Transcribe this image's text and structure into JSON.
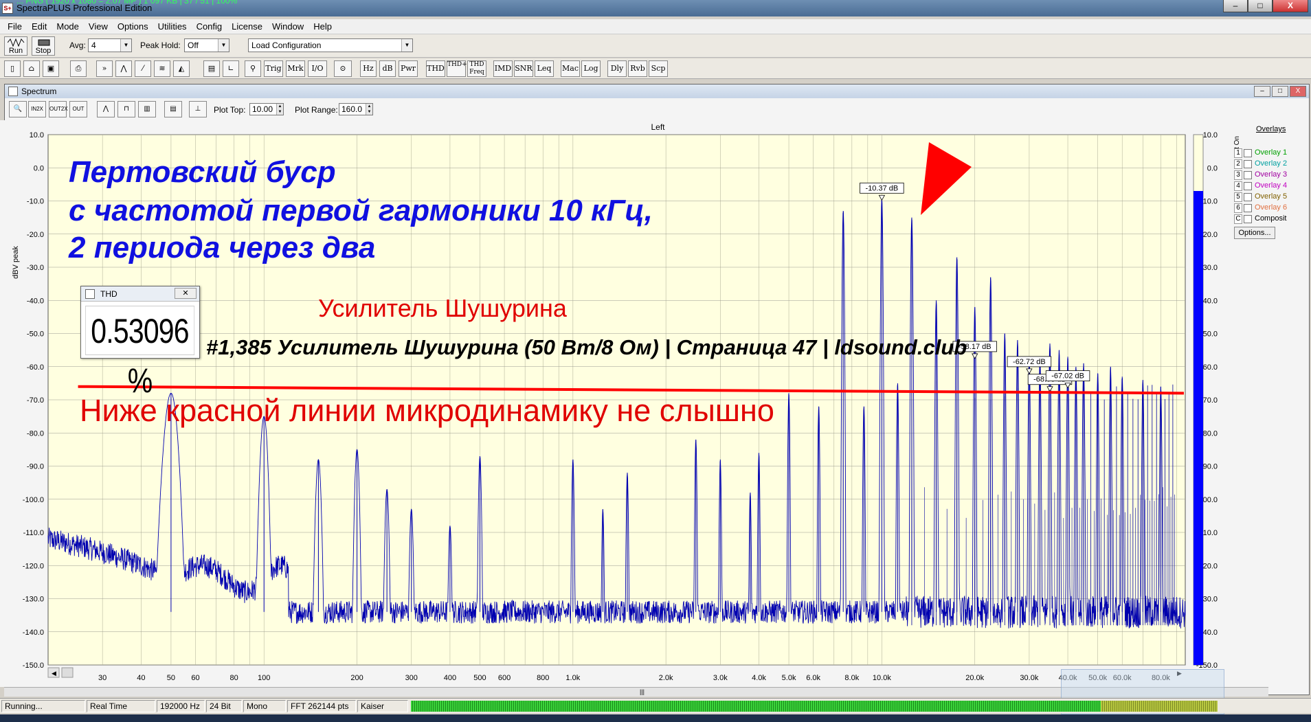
{
  "window": {
    "title": "SpectraPLUS Professional Edition",
    "overlay_text": "... PNG ( 1920 x 1080 = 2.07 MP ) 1 097 KB | 37 / 51 | 100%",
    "buttons": [
      "–",
      "□",
      "X"
    ]
  },
  "menu": [
    "File",
    "Edit",
    "Mode",
    "View",
    "Options",
    "Utilities",
    "Config",
    "License",
    "Window",
    "Help"
  ],
  "toolbar1": {
    "run_label": "Run",
    "stop_label": "Stop",
    "avg_label": "Avg:",
    "avg_value": "4",
    "peakhold_label": "Peak Hold:",
    "peakhold_value": "Off",
    "config_value": "Load Configuration"
  },
  "toolbar2": {
    "buttons": [
      "Trig",
      "Mrk",
      "I/O",
      "Hz",
      "dB",
      "Pwr",
      "THD",
      "THD+N",
      "THD Freq",
      "IMD",
      "SNR",
      "Leq",
      "Mac",
      "Log",
      "Dly",
      "Rvb",
      "Scp"
    ]
  },
  "spectrum": {
    "window_title": "Spectrum",
    "plot_top_label": "Plot Top:",
    "plot_top_value": "10.00",
    "plot_range_label": "Plot Range:",
    "plot_range_value": "160.0",
    "channel_label": "Left",
    "y_axis_label": "dBV peak",
    "overlays_title": "Overlays",
    "set_on_label": "Set On",
    "overlays": [
      {
        "num": "1",
        "label": "Overlay 1",
        "color": "#00a000"
      },
      {
        "num": "2",
        "label": "Overlay 2",
        "color": "#00a0a0"
      },
      {
        "num": "3",
        "label": "Overlay 3",
        "color": "#a000a0"
      },
      {
        "num": "4",
        "label": "Overlay 4",
        "color": "#c000c0"
      },
      {
        "num": "5",
        "label": "Overlay 5",
        "color": "#806000"
      },
      {
        "num": "6",
        "label": "Overlay 6",
        "color": "#e07040"
      },
      {
        "num": "C",
        "label": "Composit",
        "color": "#000000"
      }
    ],
    "options_label": "Options..."
  },
  "thd": {
    "title": "THD",
    "value": "0.53096 %"
  },
  "annotations": {
    "blue_line1": "Пертовский буср",
    "blue_line2": "с частотой первой гармоники 10 кГц,",
    "blue_line3": "2 периода через два",
    "red_title": "Усилитель Шушурина",
    "watermark": "#1,385 Усилитель Шушурина (50 Вт/8 Ом) | Страница 47 | ldsound.club",
    "red_bottom": "Ниже красной линии микродинамику не слышно"
  },
  "status": {
    "state": "Running...",
    "mode": "Real Time",
    "rate": "192000 Hz",
    "bits": "24 Bit",
    "channels": "Mono",
    "fft": "FFT 262144 pts",
    "window": "Kaiser"
  },
  "chart_data": {
    "type": "line",
    "title": "Left",
    "xlabel": "",
    "ylabel": "dBV peak",
    "x_scale": "log",
    "xlim": [
      20,
      96000
    ],
    "ylim": [
      -150,
      10
    ],
    "x_ticks": [
      30,
      40,
      50,
      60,
      80,
      100,
      200,
      300,
      400,
      500,
      600,
      800,
      1000,
      2000,
      3000,
      4000,
      5000,
      6000,
      8000,
      10000,
      20000,
      30000,
      40000,
      50000,
      60000,
      80000
    ],
    "x_tick_labels": [
      "30",
      "40",
      "50",
      "60",
      "80",
      "100",
      "200",
      "300",
      "400",
      "500",
      "600",
      "800",
      "1.0k",
      "2.0k",
      "3.0k",
      "4.0k",
      "5.0k",
      "6.0k",
      "8.0k",
      "10.0k",
      "20.0k",
      "30.0k",
      "40.0k",
      "50.0k",
      "60.0k",
      "80.0k"
    ],
    "y_ticks": [
      10,
      0,
      -10,
      -20,
      -30,
      -40,
      -50,
      -60,
      -70,
      -80,
      -90,
      -100,
      -110,
      -120,
      -130,
      -140,
      -150
    ],
    "y_tick_labels": [
      "10.0",
      "0.0",
      "-10.0",
      "-20.0",
      "-30.0",
      "-40.0",
      "-50.0",
      "-60.0",
      "-70.0",
      "-80.0",
      "-90.0",
      "-100.0",
      "-110.0",
      "-120.0",
      "-130.0",
      "-140.0",
      "-150.0"
    ],
    "noise_floor_db": -134,
    "peaks": [
      [
        50,
        -68
      ],
      [
        100,
        -75
      ],
      [
        150,
        -88
      ],
      [
        200,
        -85
      ],
      [
        250,
        -97
      ],
      [
        300,
        -103
      ],
      [
        400,
        -108
      ],
      [
        500,
        -87
      ],
      [
        1000,
        -88
      ],
      [
        1250,
        -103
      ],
      [
        1500,
        -92
      ],
      [
        2500,
        -82
      ],
      [
        3000,
        -88
      ],
      [
        3750,
        -98
      ],
      [
        4000,
        -86
      ],
      [
        5000,
        -68
      ],
      [
        6250,
        -72
      ],
      [
        7500,
        -13
      ],
      [
        8750,
        -72
      ],
      [
        10000,
        -9
      ],
      [
        11250,
        -65
      ],
      [
        12500,
        -15
      ],
      [
        15000,
        -40
      ],
      [
        17500,
        -27
      ],
      [
        20000,
        -42
      ],
      [
        22500,
        -33
      ],
      [
        25000,
        -50
      ],
      [
        27500,
        -52
      ],
      [
        30000,
        -57
      ],
      [
        32500,
        -57
      ],
      [
        35000,
        -53
      ],
      [
        37500,
        -55
      ],
      [
        40000,
        -57
      ],
      [
        42500,
        -60
      ],
      [
        45000,
        -59
      ],
      [
        50000,
        -62
      ],
      [
        55000,
        -60
      ],
      [
        60000,
        -63
      ],
      [
        70000,
        -64
      ],
      [
        80000,
        -66
      ]
    ],
    "markers": [
      {
        "freq": 10000,
        "db": -10.37,
        "label": "-10.37 dB"
      },
      {
        "freq": 20000,
        "db": -58.17,
        "label": "-58.17 dB"
      },
      {
        "freq": 30000,
        "db": -62.72,
        "label": "-62.72 dB"
      },
      {
        "freq": 35000,
        "db": -68.08,
        "label": "-68.08 dB"
      },
      {
        "freq": 40000,
        "db": -67.02,
        "label": "-67.02 dB"
      }
    ],
    "meter_level_db": -7,
    "red_threshold_db": [
      -66,
      -68
    ]
  }
}
